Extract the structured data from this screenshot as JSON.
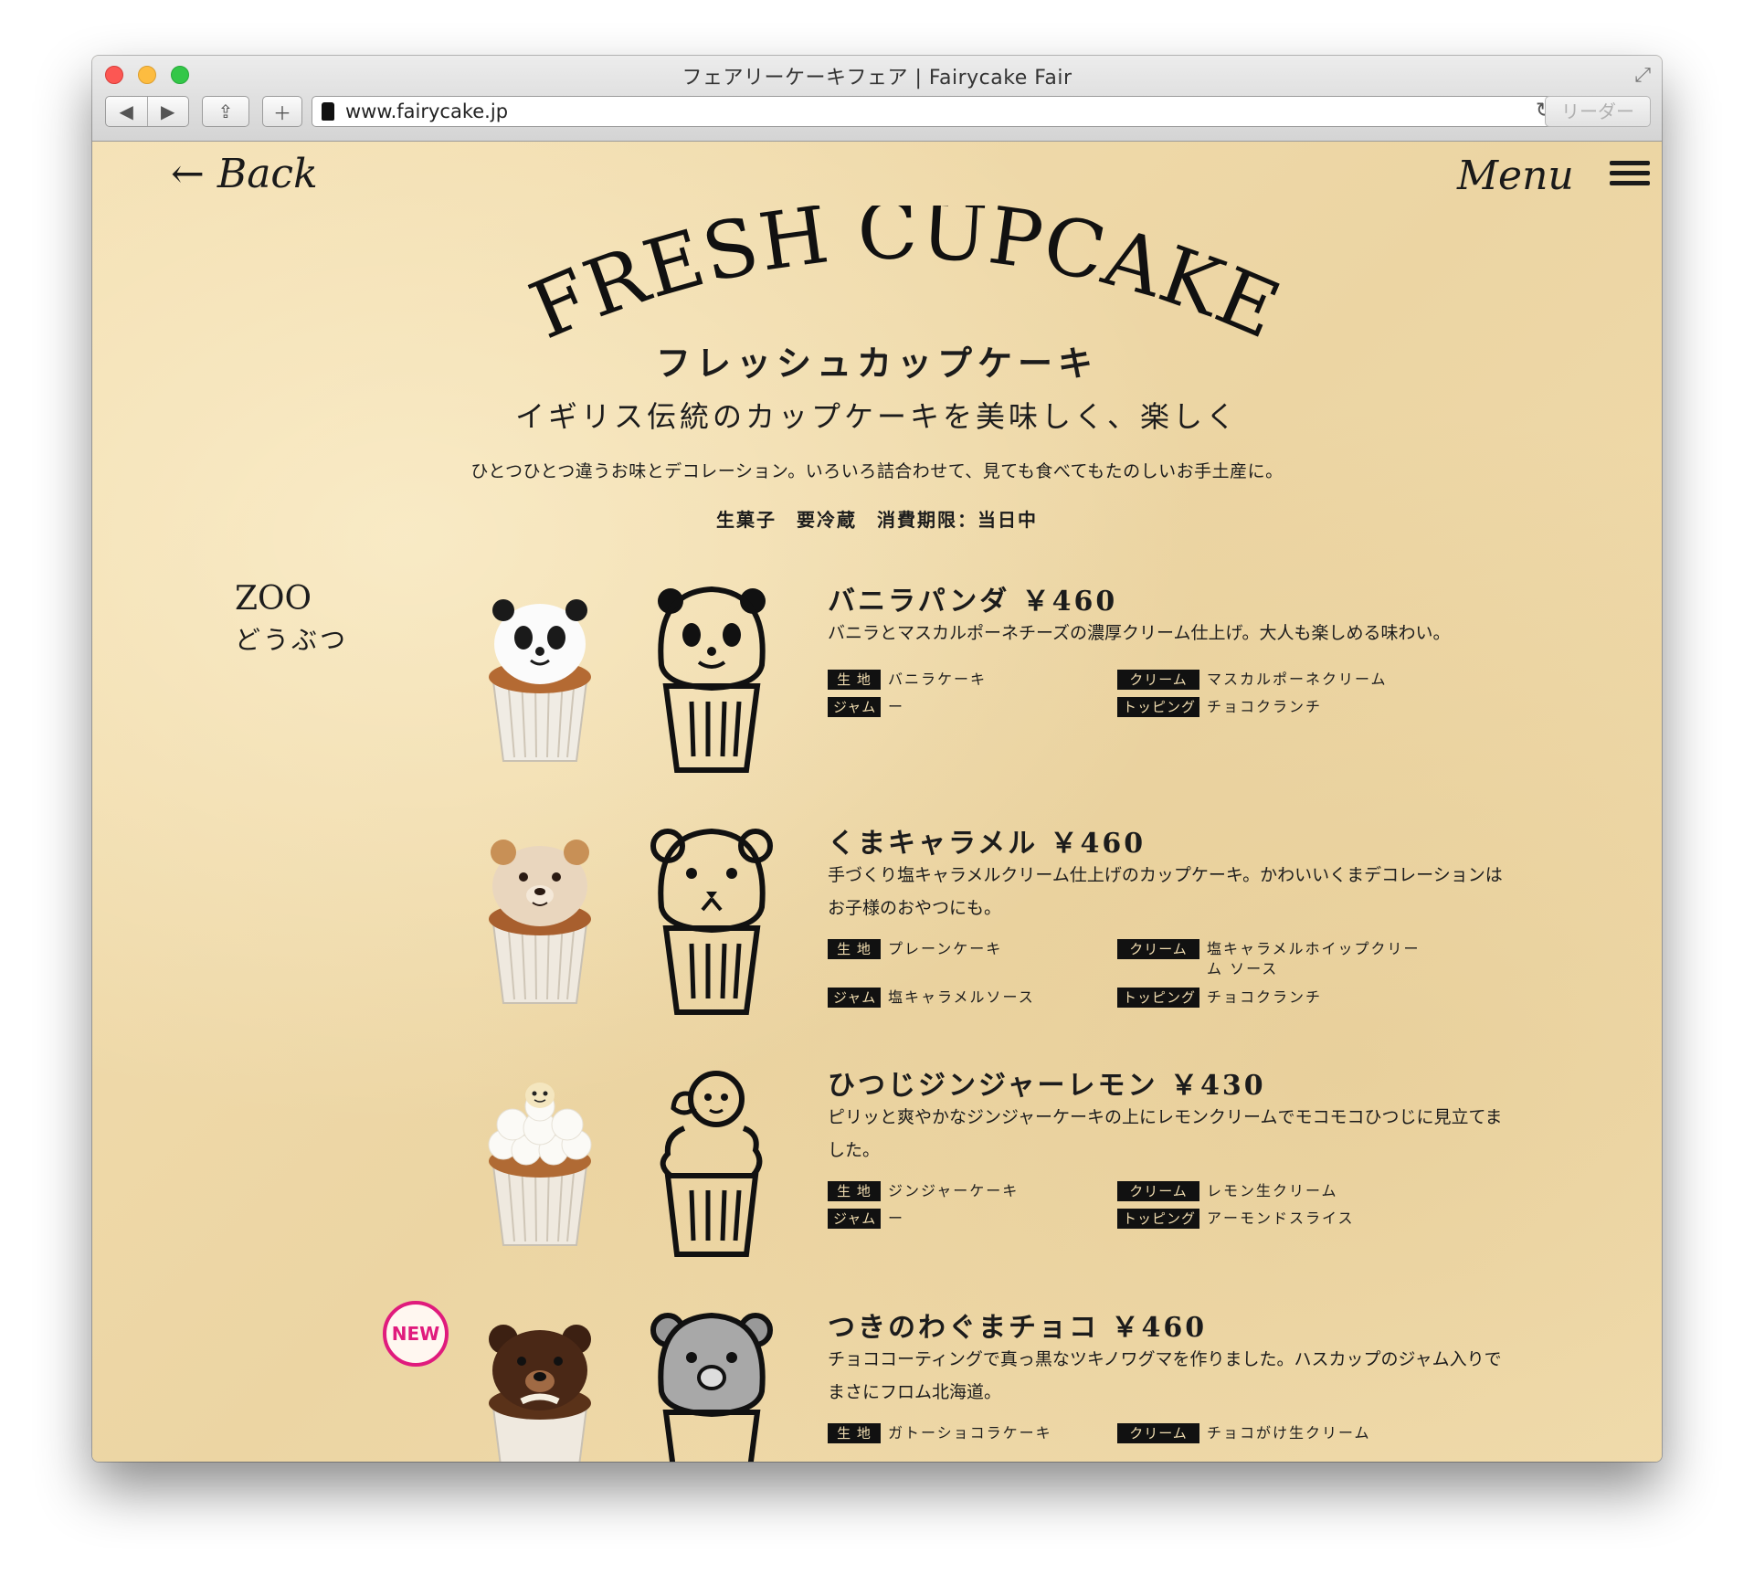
{
  "browser": {
    "title": "フェアリーケーキフェア | Fairycake Fair",
    "url": "www.fairycake.jp",
    "reader_label": "リーダー"
  },
  "nav": {
    "back_label": "← Back",
    "menu_label": "Menu"
  },
  "hero": {
    "title": "FRESH CUPCAKE",
    "subtitle": "フレッシュカップケーキ",
    "tagline": "イギリス伝統のカップケーキを美味しく、楽しく",
    "description": "ひとつひとつ違うお味とデコレーション。いろいろ詰合わせて、見ても食べてもたのしいお手土産に。",
    "notes": "生菓子　要冷蔵　消費期限：当日中"
  },
  "category": {
    "en": "ZOO",
    "jp": "どうぶつ"
  },
  "labels": {
    "base": "生 地",
    "cream": "クリーム",
    "jam": "ジャム",
    "topping": "トッピング"
  },
  "items": [
    {
      "name": "バニラパンダ ￥460",
      "description": "バニラとマスカルポーネチーズの濃厚クリーム仕上げ。大人も楽しめる味わい。",
      "base": "バニラケーキ",
      "cream": "マスカルポーネクリーム",
      "jam": "ー",
      "topping": "チョコクランチ"
    },
    {
      "name": "くまキャラメル ￥460",
      "description": "手づくり塩キャラメルクリーム仕上げのカップケーキ。かわいいくまデコレーションはお子様のおやつにも。",
      "base": "プレーンケーキ",
      "cream": "塩キャラメルホイップクリーム ソース",
      "jam": "塩キャラメルソース",
      "topping": "チョコクランチ"
    },
    {
      "name": "ひつじジンジャーレモン ￥430",
      "description": "ピリッと爽やかなジンジャーケーキの上にレモンクリームでモコモコひつじに見立てました。",
      "base": "ジンジャーケーキ",
      "cream": "レモン生クリーム",
      "jam": "ー",
      "topping": "アーモンドスライス"
    },
    {
      "name": "つきのわぐまチョコ ￥460",
      "description": "チョココーティングで真っ黒なツキノワグマを作りました。ハスカップのジャム入りでまさにフロム北海道。",
      "base": "ガトーショコラケーキ",
      "cream": "チョコがけ生クリーム",
      "badge": "NEW"
    }
  ],
  "colors": {
    "paper": "#f1ddb0",
    "ink": "#111111",
    "new_badge": "#e01b7d"
  }
}
